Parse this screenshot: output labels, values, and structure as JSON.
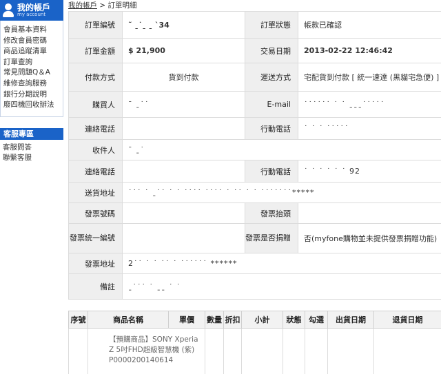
{
  "sidebar": {
    "account_title": "我的帳戶",
    "account_subtitle": "my account",
    "account_items": [
      "會員基本資料",
      "修改會員密碼",
      "商品追蹤清單",
      "訂單查詢",
      "常見問題Q＆A",
      "維修查詢服務",
      "銀行分期說明",
      "廢四機回收辦法"
    ],
    "service_title": "客服專區",
    "service_items": [
      "客服問答",
      "聯繫客服"
    ]
  },
  "breadcrumb": {
    "home": "我的帳戶",
    "separator": ">",
    "current": "訂單明細"
  },
  "order": {
    "order_no_label": "訂單編號",
    "order_no_value": "˜ ˍ˙ˍ ˍ ˋ34",
    "status_label": "訂單狀態",
    "status_value": "帳款已確認",
    "amount_label": "訂單金額",
    "amount_value": "$ 21,900",
    "date_label": "交易日期",
    "date_value": "2013-02-22 12:46:42",
    "payment_label": "付款方式",
    "payment_value": "貨到付款",
    "shipping_label": "運送方式",
    "shipping_value": "宅配貨到付款 [ 統一速達 (黑貓宅急便) ]",
    "buyer_label": "購買人",
    "buyer_value": "ˉ ˍ˙˙",
    "email_label": "E-mail",
    "email_value": "˙˙˙˙˙˙ ˙ ˙ ˍˍˍ˙˙˙˙˙",
    "contact_label": "連絡電話",
    "contact_value": "",
    "mobile_label": "行動電話",
    "mobile_value": "˙ ˙ ˙ ˙˙˙˙˙",
    "recipient_label": "收件人",
    "recipient_value": "ˉ ˍ˙",
    "contact2_label": "連絡電話",
    "contact2_value": "",
    "mobile2_label": "行動電話",
    "mobile2_value": "˙ ˙ ˙ ˙ ˙ ˙ 92",
    "address_label": "送貨地址",
    "address_value": "˙˙˙ ˙ ˍ˙˙ ˙ ˙ ˙˙˙˙ ˙˙˙˙ ˙ ˙˙ ˙ ˙ ˙˙˙˙˙˙˙*****",
    "invoice_no_label": "發票號碼",
    "invoice_no_value": "",
    "invoice_title_label": "發票抬頭",
    "invoice_title_value": "",
    "tax_id_label": "發票統一編號",
    "tax_id_value": "",
    "donate_label": "發票是否捐贈",
    "donate_value": "否(myfone購物並未提供發票捐贈功能)",
    "invoice_addr_label": "發票地址",
    "invoice_addr_value": "2˙˙ ˙ ˙ ˙˙ ˙ ˙˙˙˙˙˙ ******",
    "note_label": "備註",
    "note_value": "ˍ˙˙˙ ˙ ˍˍ ˙ ˙"
  },
  "products": {
    "headers": [
      "序號",
      "商品名稱",
      "單價",
      "數量",
      "折扣",
      "小計",
      "狀態",
      "勾選",
      "出貨日期",
      "退貨日期"
    ],
    "row1_name": "【預購商品】SONY Xperia Z 5吋FHD超級智慧機 (紫) P0000200140614"
  }
}
